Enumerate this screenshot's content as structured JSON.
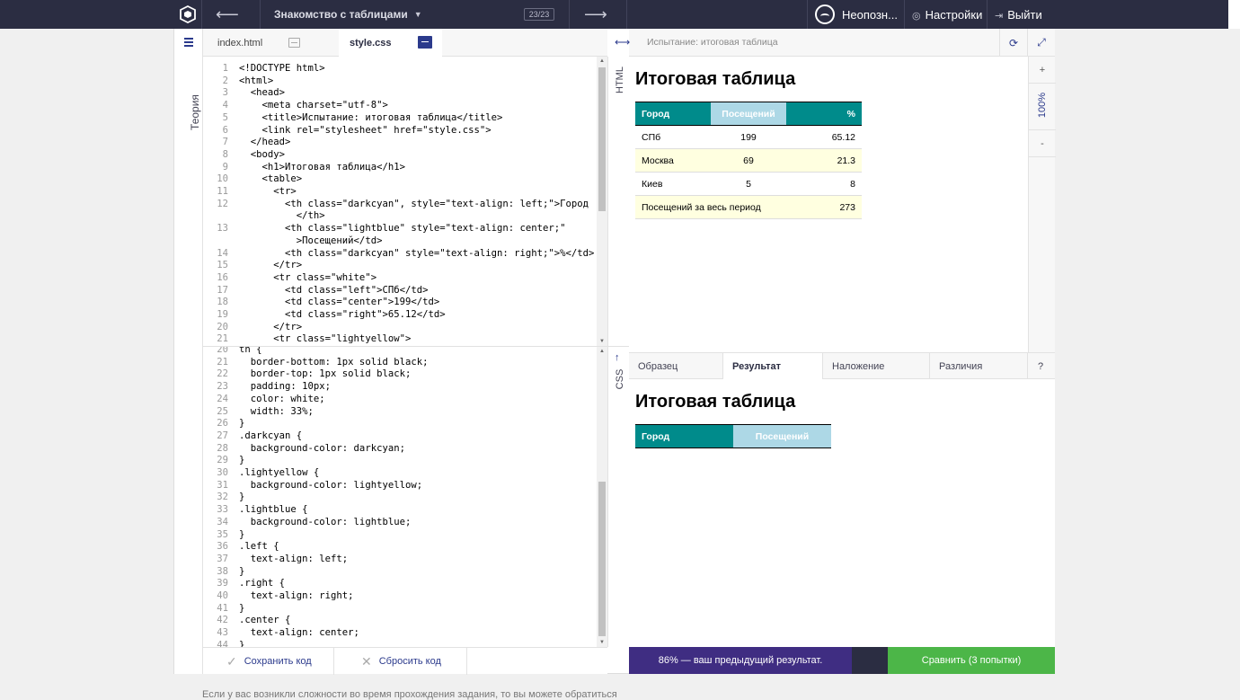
{
  "topbar": {
    "course_title": "Знакомство с таблицами",
    "progress": "23/23",
    "back_arrow": "⟵",
    "forward_arrow": "⟶",
    "user_name": "Неопозн...",
    "settings_label": "Настройки",
    "logout_label": "Выйти"
  },
  "sidebar": {
    "theory_label": "Теория"
  },
  "editor": {
    "tabs": [
      {
        "label": "index.html",
        "active": false
      },
      {
        "label": "style.css",
        "active": true
      }
    ],
    "html_label": "HTML",
    "css_label": "CSS",
    "html_lines": [
      {
        "n": "1",
        "t": "<!DOCTYPE html>"
      },
      {
        "n": "2",
        "t": "<html>"
      },
      {
        "n": "3",
        "t": "  <head>"
      },
      {
        "n": "4",
        "t": "    <meta charset=\"utf-8\">"
      },
      {
        "n": "5",
        "t": "    <title>Испытание: итоговая таблица</title>"
      },
      {
        "n": "6",
        "t": "    <link rel=\"stylesheet\" href=\"style.css\">"
      },
      {
        "n": "7",
        "t": "  </head>"
      },
      {
        "n": "8",
        "t": "  <body>"
      },
      {
        "n": "9",
        "t": "    <h1>Итоговая таблица</h1>"
      },
      {
        "n": "10",
        "t": "    <table>"
      },
      {
        "n": "11",
        "t": "      <tr>"
      },
      {
        "n": "12",
        "t": "        <th class=\"darkcyan\", style=\"text-align: left;\">Город"
      },
      {
        "n": "",
        "t": "          </th>"
      },
      {
        "n": "13",
        "t": "        <th class=\"lightblue\" style=\"text-align: center;\""
      },
      {
        "n": "",
        "t": "          >Посещений</td>"
      },
      {
        "n": "14",
        "t": "        <th class=\"darkcyan\" style=\"text-align: right;\">%</td>"
      },
      {
        "n": "15",
        "t": "      </tr>"
      },
      {
        "n": "16",
        "t": "      <tr class=\"white\">"
      },
      {
        "n": "17",
        "t": "        <td class=\"left\">СПб</td>"
      },
      {
        "n": "18",
        "t": "        <td class=\"center\">199</td>"
      },
      {
        "n": "19",
        "t": "        <td class=\"right\">65.12</td>"
      },
      {
        "n": "20",
        "t": "      </tr>"
      },
      {
        "n": "21",
        "t": "      <tr class=\"lightyellow\">"
      }
    ],
    "css_lines": [
      {
        "n": "20",
        "t": "th {"
      },
      {
        "n": "21",
        "t": "  border-bottom: 1px solid black;"
      },
      {
        "n": "22",
        "t": "  border-top: 1px solid black;"
      },
      {
        "n": "23",
        "t": "  padding: 10px;"
      },
      {
        "n": "24",
        "t": "  color: white;"
      },
      {
        "n": "25",
        "t": "  width: 33%;"
      },
      {
        "n": "26",
        "t": "}"
      },
      {
        "n": "27",
        "t": ".darkcyan {"
      },
      {
        "n": "28",
        "t": "  background-color: darkcyan;"
      },
      {
        "n": "29",
        "t": "}"
      },
      {
        "n": "30",
        "t": ".lightyellow {"
      },
      {
        "n": "31",
        "t": "  background-color: lightyellow;"
      },
      {
        "n": "32",
        "t": "}"
      },
      {
        "n": "33",
        "t": ".lightblue {"
      },
      {
        "n": "34",
        "t": "  background-color: lightblue;"
      },
      {
        "n": "35",
        "t": "}"
      },
      {
        "n": "36",
        "t": ".left {"
      },
      {
        "n": "37",
        "t": "  text-align: left;"
      },
      {
        "n": "38",
        "t": "}"
      },
      {
        "n": "39",
        "t": ".right {"
      },
      {
        "n": "40",
        "t": "  text-align: right;"
      },
      {
        "n": "41",
        "t": "}"
      },
      {
        "n": "42",
        "t": ".center {"
      },
      {
        "n": "43",
        "t": "  text-align: center;"
      },
      {
        "n": "44",
        "t": "}"
      }
    ],
    "save_label": "Сохранить код",
    "reset_label": "Сбросить код"
  },
  "preview": {
    "header_title": "Испытание: итоговая таблица",
    "zoom_level": "100%",
    "zoom_in": "+",
    "zoom_out": "-",
    "heading": "Итоговая таблица",
    "table_headers": [
      "Город",
      "Посещений",
      "%"
    ],
    "table_rows": [
      [
        "СПб",
        "199",
        "65.12"
      ],
      [
        "Москва",
        "69",
        "21.3"
      ],
      [
        "Киев",
        "5",
        "8"
      ]
    ],
    "total_label": "Посещений за весь период",
    "total_value": "273"
  },
  "result_tabs": [
    "Образец",
    "Результат",
    "Наложение",
    "Различия",
    "?"
  ],
  "result": {
    "heading": "Итоговая таблица",
    "table_headers": [
      "Город",
      "Посещений"
    ]
  },
  "footer": {
    "previous_result": "86% — ваш предыдущий результат.",
    "compare_label": "Сравнить (3 попытки)"
  },
  "help_text": "Если у вас возникли сложности во время прохождения задания, то вы можете обратиться",
  "colors": {
    "topbar": "#2b2d42",
    "accent": "#2b3a8c",
    "darkcyan": "#008b8b",
    "lightblue": "#add8e6",
    "lightyellow": "#ffffe0",
    "compare_green": "#4cb648",
    "prev_purple": "#3f2d82"
  }
}
